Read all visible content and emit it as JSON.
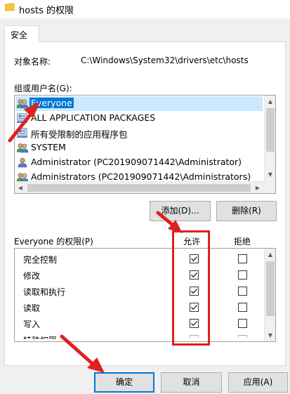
{
  "window": {
    "title": "hosts 的权限",
    "folder_icon": "folder-icon"
  },
  "tab": {
    "label": "安全"
  },
  "object": {
    "label": "对象名称:",
    "value": "C:\\Windows\\System32\\drivers\\etc\\hosts"
  },
  "groups": {
    "label": "组或用户名(G):",
    "items": [
      {
        "label": "Everyone",
        "icon": "users-icon",
        "selected": true
      },
      {
        "label": "ALL APPLICATION PACKAGES",
        "icon": "app-packages-icon",
        "selected": false
      },
      {
        "label": "所有受限制的应用程序包",
        "icon": "app-packages-icon",
        "selected": false
      },
      {
        "label": "SYSTEM",
        "icon": "users-icon",
        "selected": false
      },
      {
        "label": "Administrator (PC201909071442\\Administrator)",
        "icon": "user-icon",
        "selected": false
      },
      {
        "label": "Administrators (PC201909071442\\Administrators)",
        "icon": "users-icon",
        "selected": false
      }
    ],
    "add_button": "添加(D)...",
    "remove_button": "删除(R)"
  },
  "permissions": {
    "label": "Everyone 的权限(P)",
    "allow_header": "允许",
    "deny_header": "拒绝",
    "rows": [
      {
        "name": "完全控制",
        "allow": true,
        "deny": false
      },
      {
        "name": "修改",
        "allow": true,
        "deny": false
      },
      {
        "name": "读取和执行",
        "allow": true,
        "deny": false
      },
      {
        "name": "读取",
        "allow": true,
        "deny": false
      },
      {
        "name": "写入",
        "allow": true,
        "deny": false
      },
      {
        "name": "特殊权限",
        "allow": false,
        "deny": false
      }
    ]
  },
  "footer": {
    "ok": "确定",
    "cancel": "取消",
    "apply": "应用(A)"
  },
  "colors": {
    "annotation": "#e02020",
    "selection": "#0078d7"
  }
}
